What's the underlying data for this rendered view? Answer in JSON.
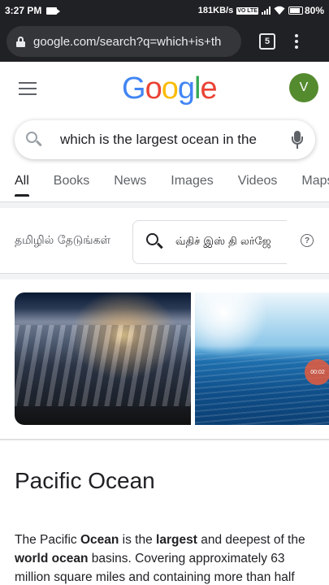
{
  "status_bar": {
    "time": "3:27 PM",
    "network_speed": "181KB/s",
    "volte": "VO LTE",
    "battery": "80%",
    "icons": [
      "recording-icon",
      "signal-icon",
      "wifi-icon",
      "battery-icon"
    ]
  },
  "browser": {
    "url": "google.com/search?q=which+is+th",
    "tab_count": "5"
  },
  "header": {
    "logo": [
      "G",
      "o",
      "o",
      "g",
      "l",
      "e"
    ],
    "avatar_letter": "V",
    "avatar_color": "#558b2f"
  },
  "search": {
    "query": "which is the largest ocean in the"
  },
  "tabs": [
    {
      "label": "All",
      "active": true
    },
    {
      "label": "Books"
    },
    {
      "label": "News"
    },
    {
      "label": "Images"
    },
    {
      "label": "Videos"
    },
    {
      "label": "Maps"
    }
  ],
  "translate_strip": {
    "label": "தமிழில் தேடுங்கள்",
    "query": "வ்திச் இஸ் தி லர்ஜே",
    "help": "?"
  },
  "images": {
    "video_time": "00:02"
  },
  "knowledge_panel": {
    "title": "Pacific Ocean",
    "desc_parts": [
      {
        "text": "The Pacific ",
        "bold": false
      },
      {
        "text": "Ocean",
        "bold": true
      },
      {
        "text": " is the ",
        "bold": false
      },
      {
        "text": "largest",
        "bold": true
      },
      {
        "text": " and deepest of the ",
        "bold": false
      },
      {
        "text": "world ocean",
        "bold": true
      },
      {
        "text": " basins. Covering approximately 63 million square miles and containing more than half",
        "bold": false
      }
    ]
  },
  "colors": {
    "chrome_bar": "#202124",
    "url_box": "#35363a",
    "accent_blue": "#4285f4"
  }
}
